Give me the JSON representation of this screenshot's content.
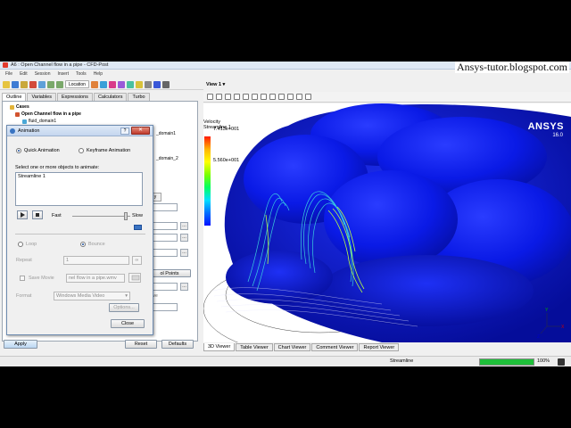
{
  "watermark": "Ansys-tutor.blogspot.com",
  "window": {
    "title": "A6 : Open Channel flow in a pipe - CFD-Post"
  },
  "menu": [
    "File",
    "Edit",
    "Session",
    "Insert",
    "Tools",
    "Help"
  ],
  "toolbar": {
    "location_label": "Location"
  },
  "view": {
    "label": "View 1"
  },
  "left_tabs": [
    "Outline",
    "Variables",
    "Expressions",
    "Calculators",
    "Turbo"
  ],
  "tree": {
    "cases": "Cases",
    "case": "Open Channel flow in a pipe",
    "domain": "fluid_domain1",
    "partial_1": "_domain1",
    "partial_2": "_domain_2"
  },
  "left_lower": {
    "partial_tab": "y",
    "points_button": "ol Points",
    "partial_text": "tive"
  },
  "bottom_buttons": {
    "apply": "Apply",
    "reset": "Reset",
    "defaults": "Defaults"
  },
  "legend": {
    "title_1": "Velocity",
    "title_2": "Streamline 1",
    "max": "7.413e+001",
    "v2": "5.560e+001",
    "v3": "3.",
    "v4": "0.",
    "unit": "[m s^-1]"
  },
  "ansys": {
    "logo": "ANSYS",
    "version": "16.0"
  },
  "viewer_tabs": [
    "3D Viewer",
    "Table Viewer",
    "Chart Viewer",
    "Comment Viewer",
    "Report Viewer"
  ],
  "status": {
    "text": "Streamline",
    "progress_label": "100%",
    "progress_value": 1.0
  },
  "dialog": {
    "title": "Animation",
    "help": "?",
    "close": "✕",
    "quick": "Quick Animation",
    "keyframe": "Keyframe Animation",
    "select_label": "Select one or more objects to animate:",
    "list_items": [
      "Streamline 1"
    ],
    "fast": "Fast",
    "slow": "Slow",
    "loop": "Loop",
    "bounce": "Bounce",
    "repeat": "Repeat",
    "repeat_value": "1",
    "save_movie": "Save Movie",
    "movie_file": "nel flow in a pipe.wmv",
    "format": "Format",
    "format_value": "Windows Media Video",
    "options": "Options...",
    "close_btn": "Close",
    "infinity": "∞"
  }
}
